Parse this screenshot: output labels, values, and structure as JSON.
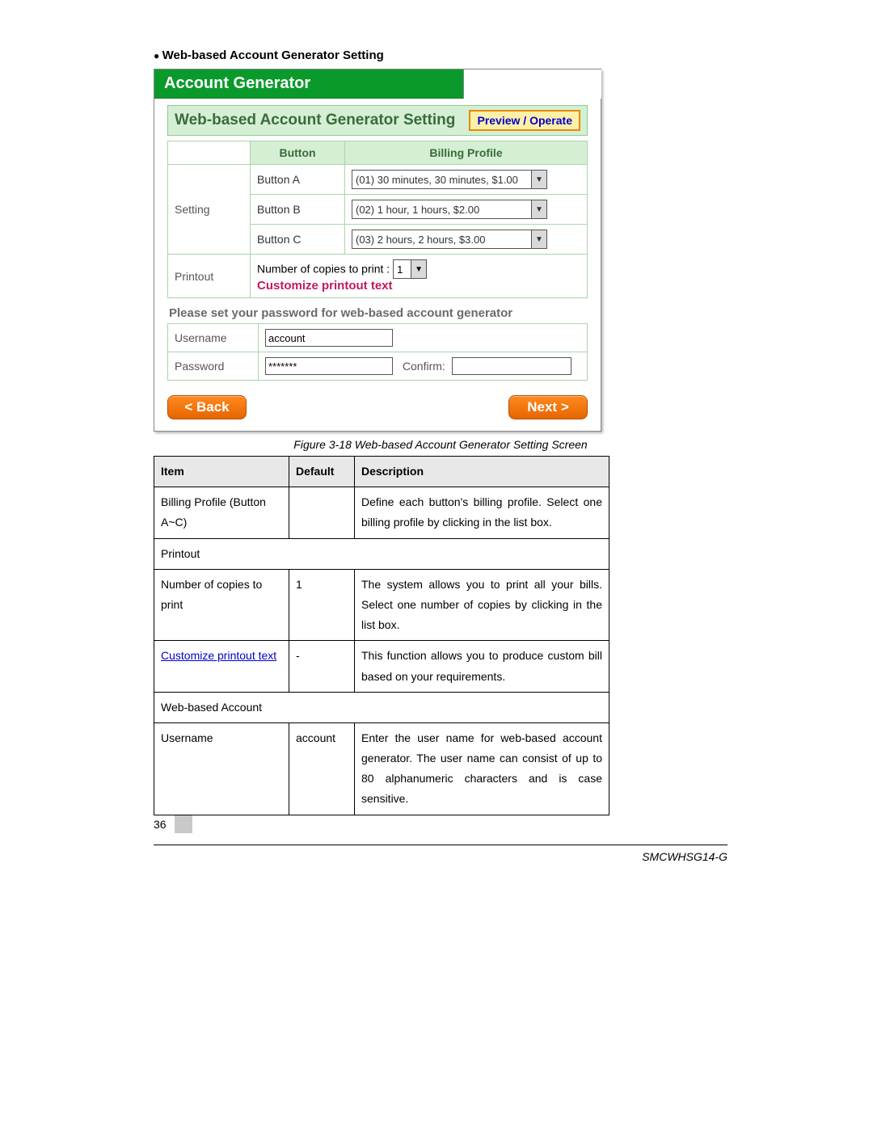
{
  "heading": "Web-based Account Generator Setting",
  "panel": {
    "titlebar": "Account Generator",
    "section_title": "Web-based Account Generator Setting",
    "preview_btn": "Preview / Operate",
    "col_button": "Button",
    "col_profile": "Billing Profile",
    "setting_label": "Setting",
    "rows": [
      {
        "btn": "Button A",
        "profile": "(01) 30 minutes, 30 minutes, $1.00"
      },
      {
        "btn": "Button B",
        "profile": "(02) 1 hour, 1 hours, $2.00"
      },
      {
        "btn": "Button C",
        "profile": "(03) 2 hours, 2 hours, $3.00"
      }
    ],
    "printout_label": "Printout",
    "copies_prefix": "Number of copies to print :",
    "copies_value": "1",
    "customize_link": "Customize printout text",
    "pwd_note": "Please set your password for web-based account generator",
    "username_label": "Username",
    "username_value": "account",
    "password_label": "Password",
    "password_value": "*******",
    "confirm_label": "Confirm:",
    "confirm_value": "",
    "back_btn": "< Back",
    "next_btn": "Next >"
  },
  "caption": "Figure 3-18 Web-based Account Generator Setting Screen",
  "desc": {
    "h_item": "Item",
    "h_default": "Default",
    "h_desc": "Description",
    "rows": [
      {
        "type": "row",
        "item": "Billing Profile (Button A~C)",
        "def": "",
        "desc": "Define each button's billing profile. Select one billing profile by clicking in the list box."
      },
      {
        "type": "section",
        "item": "Printout"
      },
      {
        "type": "row",
        "item": "Number of copies to print",
        "def": "1",
        "desc": "The system allows you to print all your bills. Select one number of copies by clicking in the list box."
      },
      {
        "type": "row",
        "item_link": "Customize printout text",
        "def": "-",
        "desc": "This function allows you to produce custom bill based on your requirements."
      },
      {
        "type": "section",
        "item": "Web-based Account"
      },
      {
        "type": "row",
        "item": "Username",
        "def": "account",
        "desc": "Enter the user name for web-based account generator. The user name can consist of up to 80 alphanumeric characters and is case sensitive."
      }
    ]
  },
  "page_number": "36",
  "footer": "SMCWHSG14-G"
}
